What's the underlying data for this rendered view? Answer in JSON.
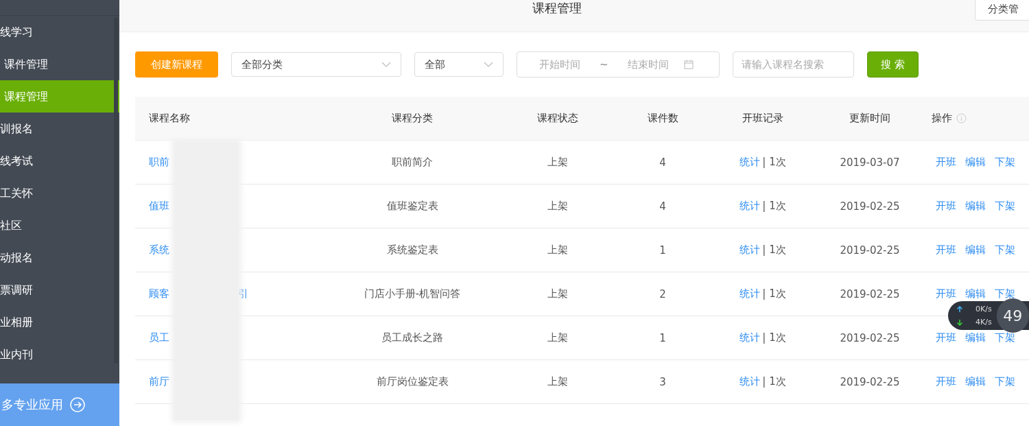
{
  "sidebar": {
    "items": [
      {
        "label": "线学习",
        "sub": false,
        "selected": false
      },
      {
        "label": "课件管理",
        "sub": true,
        "selected": false
      },
      {
        "label": "课程管理",
        "sub": true,
        "selected": true
      },
      {
        "label": "训报名",
        "sub": false,
        "selected": false
      },
      {
        "label": "线考试",
        "sub": false,
        "selected": false
      },
      {
        "label": "工关怀",
        "sub": false,
        "selected": false
      },
      {
        "label": "社区",
        "sub": false,
        "selected": false
      },
      {
        "label": "动报名",
        "sub": false,
        "selected": false
      },
      {
        "label": "票调研",
        "sub": false,
        "selected": false
      },
      {
        "label": "业相册",
        "sub": false,
        "selected": false
      },
      {
        "label": "业内刊",
        "sub": false,
        "selected": false
      }
    ],
    "more": "多专业应用"
  },
  "header": {
    "title": "课程管理",
    "button": "分类管"
  },
  "toolbar": {
    "create": "创建新课程",
    "category": "全部分类",
    "status": "全部",
    "start_placeholder": "开始时间",
    "separator": "~",
    "end_placeholder": "结束时间",
    "search_placeholder": "请输入课程名搜索",
    "search": "搜 索"
  },
  "table": {
    "columns": [
      "课程名称",
      "课程分类",
      "课程状态",
      "课件数",
      "开班记录",
      "更新时间",
      "操作"
    ],
    "rows": [
      {
        "name": "职前",
        "name_end": "",
        "category": "职前简介",
        "status": "上架",
        "count": "4",
        "stats": "统计",
        "times": "| 1次",
        "updated": "2019-03-07",
        "actions": [
          "开班",
          "编辑",
          "下架"
        ]
      },
      {
        "name": "值班",
        "name_end": "",
        "category": "值班鉴定表",
        "status": "上架",
        "count": "4",
        "stats": "统计",
        "times": "| 1次",
        "updated": "2019-02-25",
        "actions": [
          "开班",
          "编辑",
          "下架"
        ]
      },
      {
        "name": "系统",
        "name_end": "",
        "category": "系统鉴定表",
        "status": "上架",
        "count": "1",
        "stats": "统计",
        "times": "| 1次",
        "updated": "2019-02-25",
        "actions": [
          "开班",
          "编辑",
          "下架"
        ]
      },
      {
        "name": "顾客",
        "name_end": "引",
        "category": "门店小手册-机智问答",
        "status": "上架",
        "count": "2",
        "stats": "统计",
        "times": "| 1次",
        "updated": "2019-02-25",
        "actions": [
          "开班",
          "编辑",
          "下架"
        ]
      },
      {
        "name": "员工",
        "name_end": "",
        "category": "员工成长之路",
        "status": "上架",
        "count": "1",
        "stats": "统计",
        "times": "| 1次",
        "updated": "2019-02-25",
        "actions": [
          "开班",
          "编辑",
          "下架"
        ]
      },
      {
        "name": "前厅",
        "name_end": "",
        "category": "前厅岗位鉴定表",
        "status": "上架",
        "count": "3",
        "stats": "统计",
        "times": "| 1次",
        "updated": "2019-02-25",
        "actions": [
          "开班",
          "编辑",
          "下架"
        ]
      }
    ]
  },
  "net_widget": {
    "up": "0K/s",
    "down": "4K/s",
    "value": "49"
  }
}
